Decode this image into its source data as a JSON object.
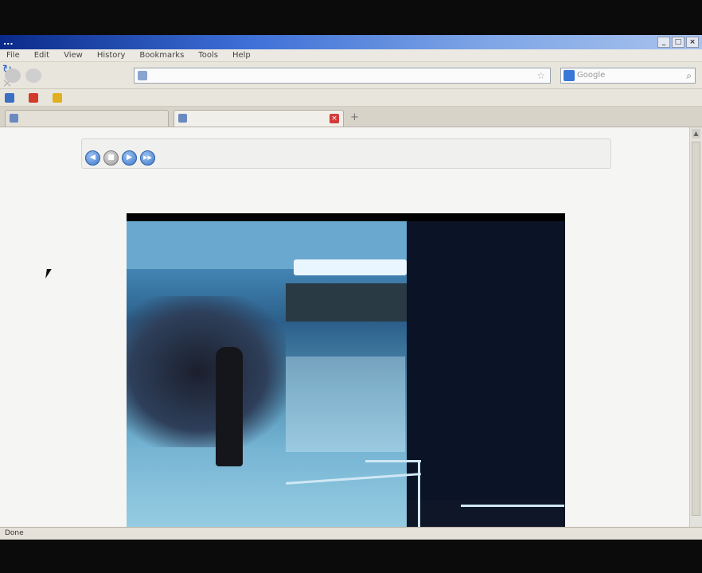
{
  "window": {
    "title_main": "...",
    "title_sub": "",
    "controls": {
      "minimize": "_",
      "maximize": "□",
      "close": "×"
    }
  },
  "menubar": {
    "items": [
      "File",
      "Edit",
      "View",
      "History",
      "Bookmarks",
      "Tools",
      "Help"
    ]
  },
  "navbar": {
    "reload_glyph": "↻",
    "stop_glyph": "✕",
    "home_glyph": "⌂",
    "url_value": "",
    "search_placeholder": "Google",
    "go_glyph": "⌕",
    "star_glyph": "☆"
  },
  "bookmarks": {
    "items": [
      {
        "label": "",
        "color": "#3a6fc4"
      },
      {
        "label": "",
        "color": "#d23a2a"
      },
      {
        "label": "",
        "color": "#e0b020"
      }
    ]
  },
  "tabs": {
    "items": [
      {
        "label": ""
      },
      {
        "label": ""
      }
    ],
    "close_glyph": "×",
    "new_tab_glyph": "+"
  },
  "page": {
    "panel_label": "",
    "controls": [
      {
        "glyph": "◀",
        "style": "blue"
      },
      {
        "glyph": "■",
        "style": "gray"
      },
      {
        "glyph": "▶",
        "style": "blue"
      },
      {
        "glyph": "▶▶",
        "style": "blue"
      }
    ],
    "camera_overlay_text": ""
  },
  "statusbar": {
    "text": "Done"
  },
  "scrollbar": {
    "up_glyph": "▲"
  }
}
